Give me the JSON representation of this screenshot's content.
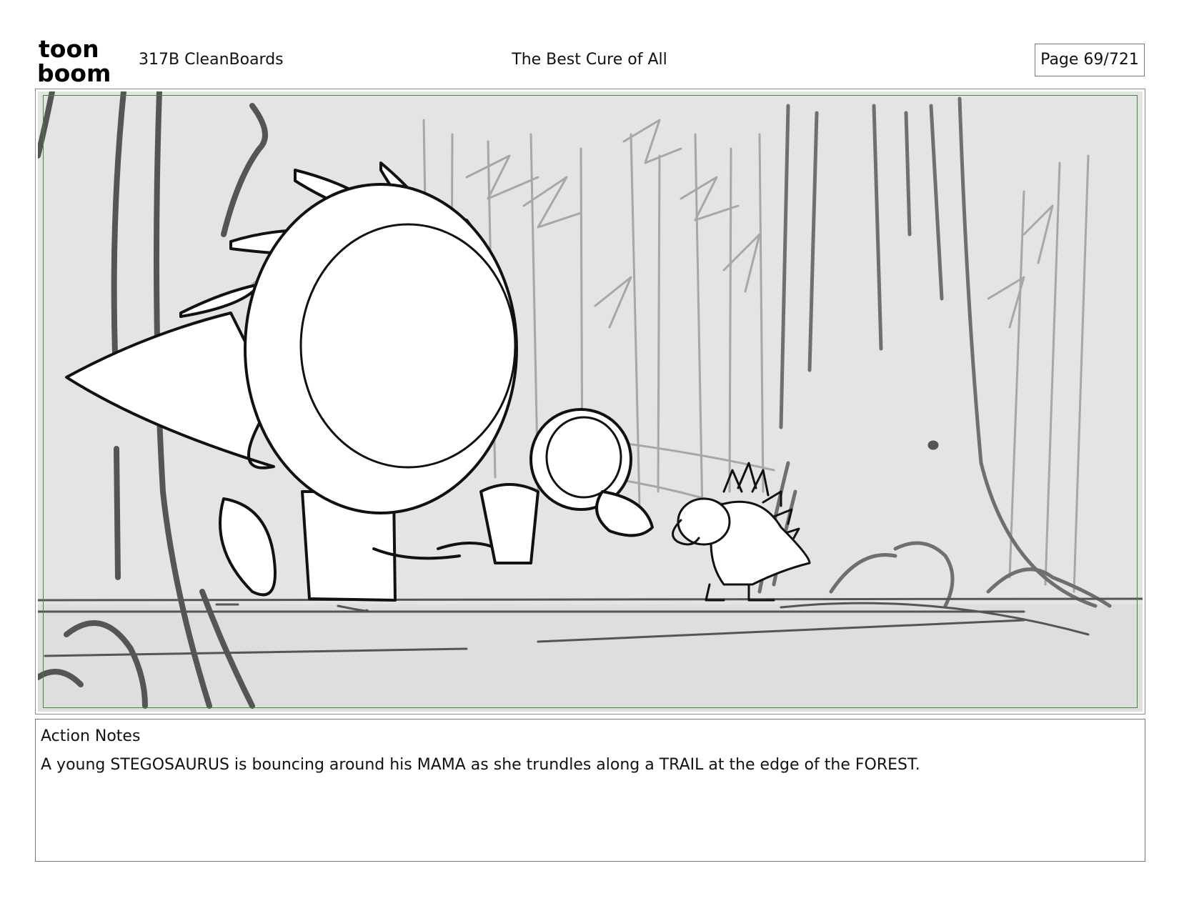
{
  "logo": {
    "line1": "toon",
    "line2": "boom",
    "icon": "toon-boom-logo"
  },
  "header": {
    "project": "317B  CleanBoards",
    "title": "The Best Cure of All",
    "page": "Page  69/721"
  },
  "panel": {
    "image": "storyboard-panel-drawing",
    "safe_frame_color": "#3c8c3c"
  },
  "notes": {
    "heading": "Action Notes",
    "text": "A young STEGOSAURUS is bouncing around his MAMA as she trundles along a TRAIL at the edge of the FOREST."
  }
}
